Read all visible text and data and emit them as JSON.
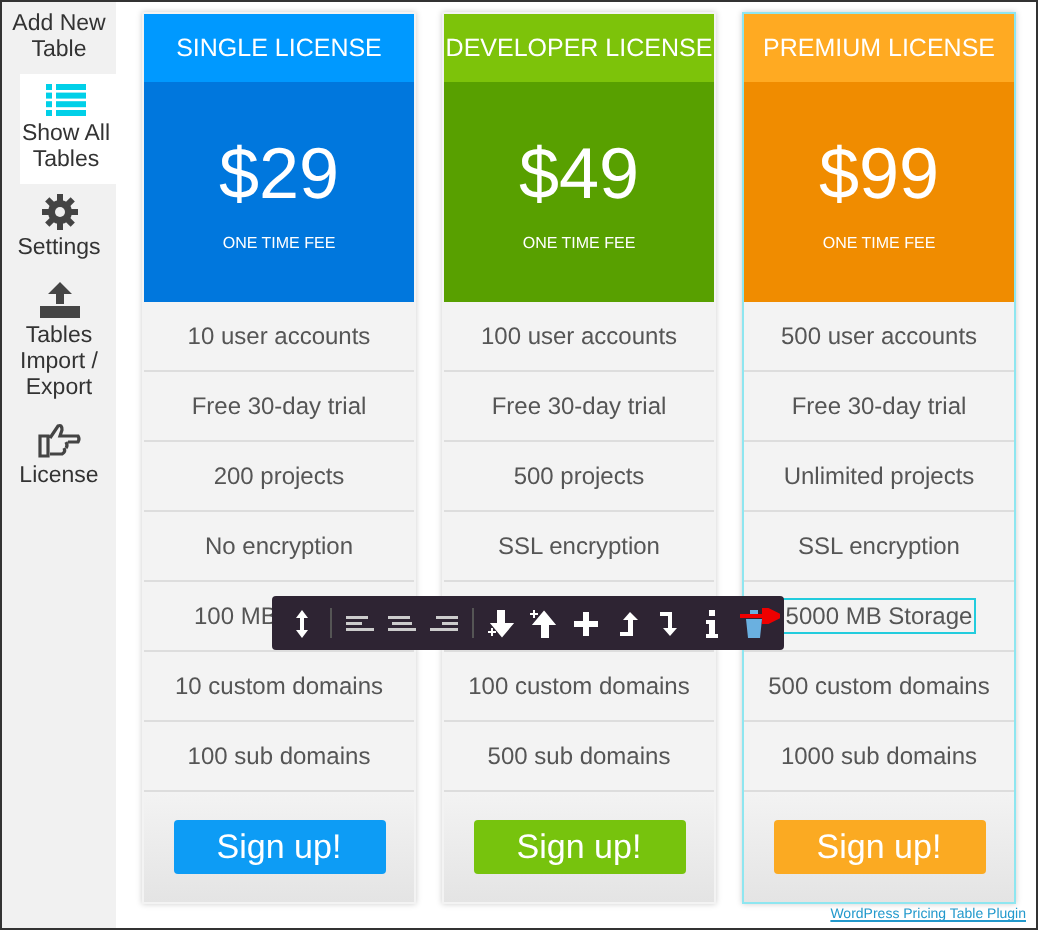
{
  "sidebar": {
    "items": [
      {
        "label": "Add New Table",
        "selected": false
      },
      {
        "label": "Show All Tables",
        "selected": true
      },
      {
        "label": "Settings",
        "selected": false
      },
      {
        "label": "Tables Import / Export",
        "selected": false
      },
      {
        "label": "License",
        "selected": false
      }
    ]
  },
  "plans": [
    {
      "title": "SINGLE LICENSE",
      "price": "$29",
      "fee": "ONE TIME FEE",
      "color": "#0099ff",
      "selected": false,
      "features": [
        {
          "kind": "text",
          "text": "10 user accounts"
        },
        {
          "kind": "text",
          "text": "Free 30-day trial"
        },
        {
          "kind": "text",
          "text": "200 projects"
        },
        {
          "kind": "text",
          "text": "No encryption"
        },
        {
          "kind": "clipped",
          "text": "100 MB"
        },
        {
          "kind": "text",
          "text": "10 custom domains"
        },
        {
          "kind": "text",
          "text": "100 sub domains"
        }
      ],
      "button": "Sign up!"
    },
    {
      "title": "DEVELOPER LICENSE",
      "price": "$49",
      "fee": "ONE TIME FEE",
      "color": "#7dc30a",
      "selected": false,
      "features": [
        {
          "kind": "text",
          "text": "100 user accounts"
        },
        {
          "kind": "text",
          "text": "Free 30-day trial"
        },
        {
          "kind": "text",
          "text": "500 projects"
        },
        {
          "kind": "text",
          "text": "SSL encryption"
        },
        {
          "kind": "covered"
        },
        {
          "kind": "text",
          "text": "100 custom domains"
        },
        {
          "kind": "text",
          "text": "500 sub domains"
        }
      ],
      "button": "Sign up!"
    },
    {
      "title": "PREMIUM LICENSE",
      "price": "$99",
      "fee": "ONE TIME FEE",
      "color": "#ffaa22",
      "selected": true,
      "features": [
        {
          "kind": "text",
          "text": "500 user accounts"
        },
        {
          "kind": "text",
          "text": "Free 30-day trial"
        },
        {
          "kind": "text",
          "text": "Unlimited projects"
        },
        {
          "kind": "text",
          "text": "SSL encryption"
        },
        {
          "kind": "editing",
          "text": "5000 MB Storage"
        },
        {
          "kind": "text",
          "text": "500 custom domains"
        },
        {
          "kind": "text",
          "text": "1000 sub domains"
        }
      ],
      "button": "Sign up!"
    }
  ],
  "footer_link": "WordPress Pricing Table Plugin"
}
